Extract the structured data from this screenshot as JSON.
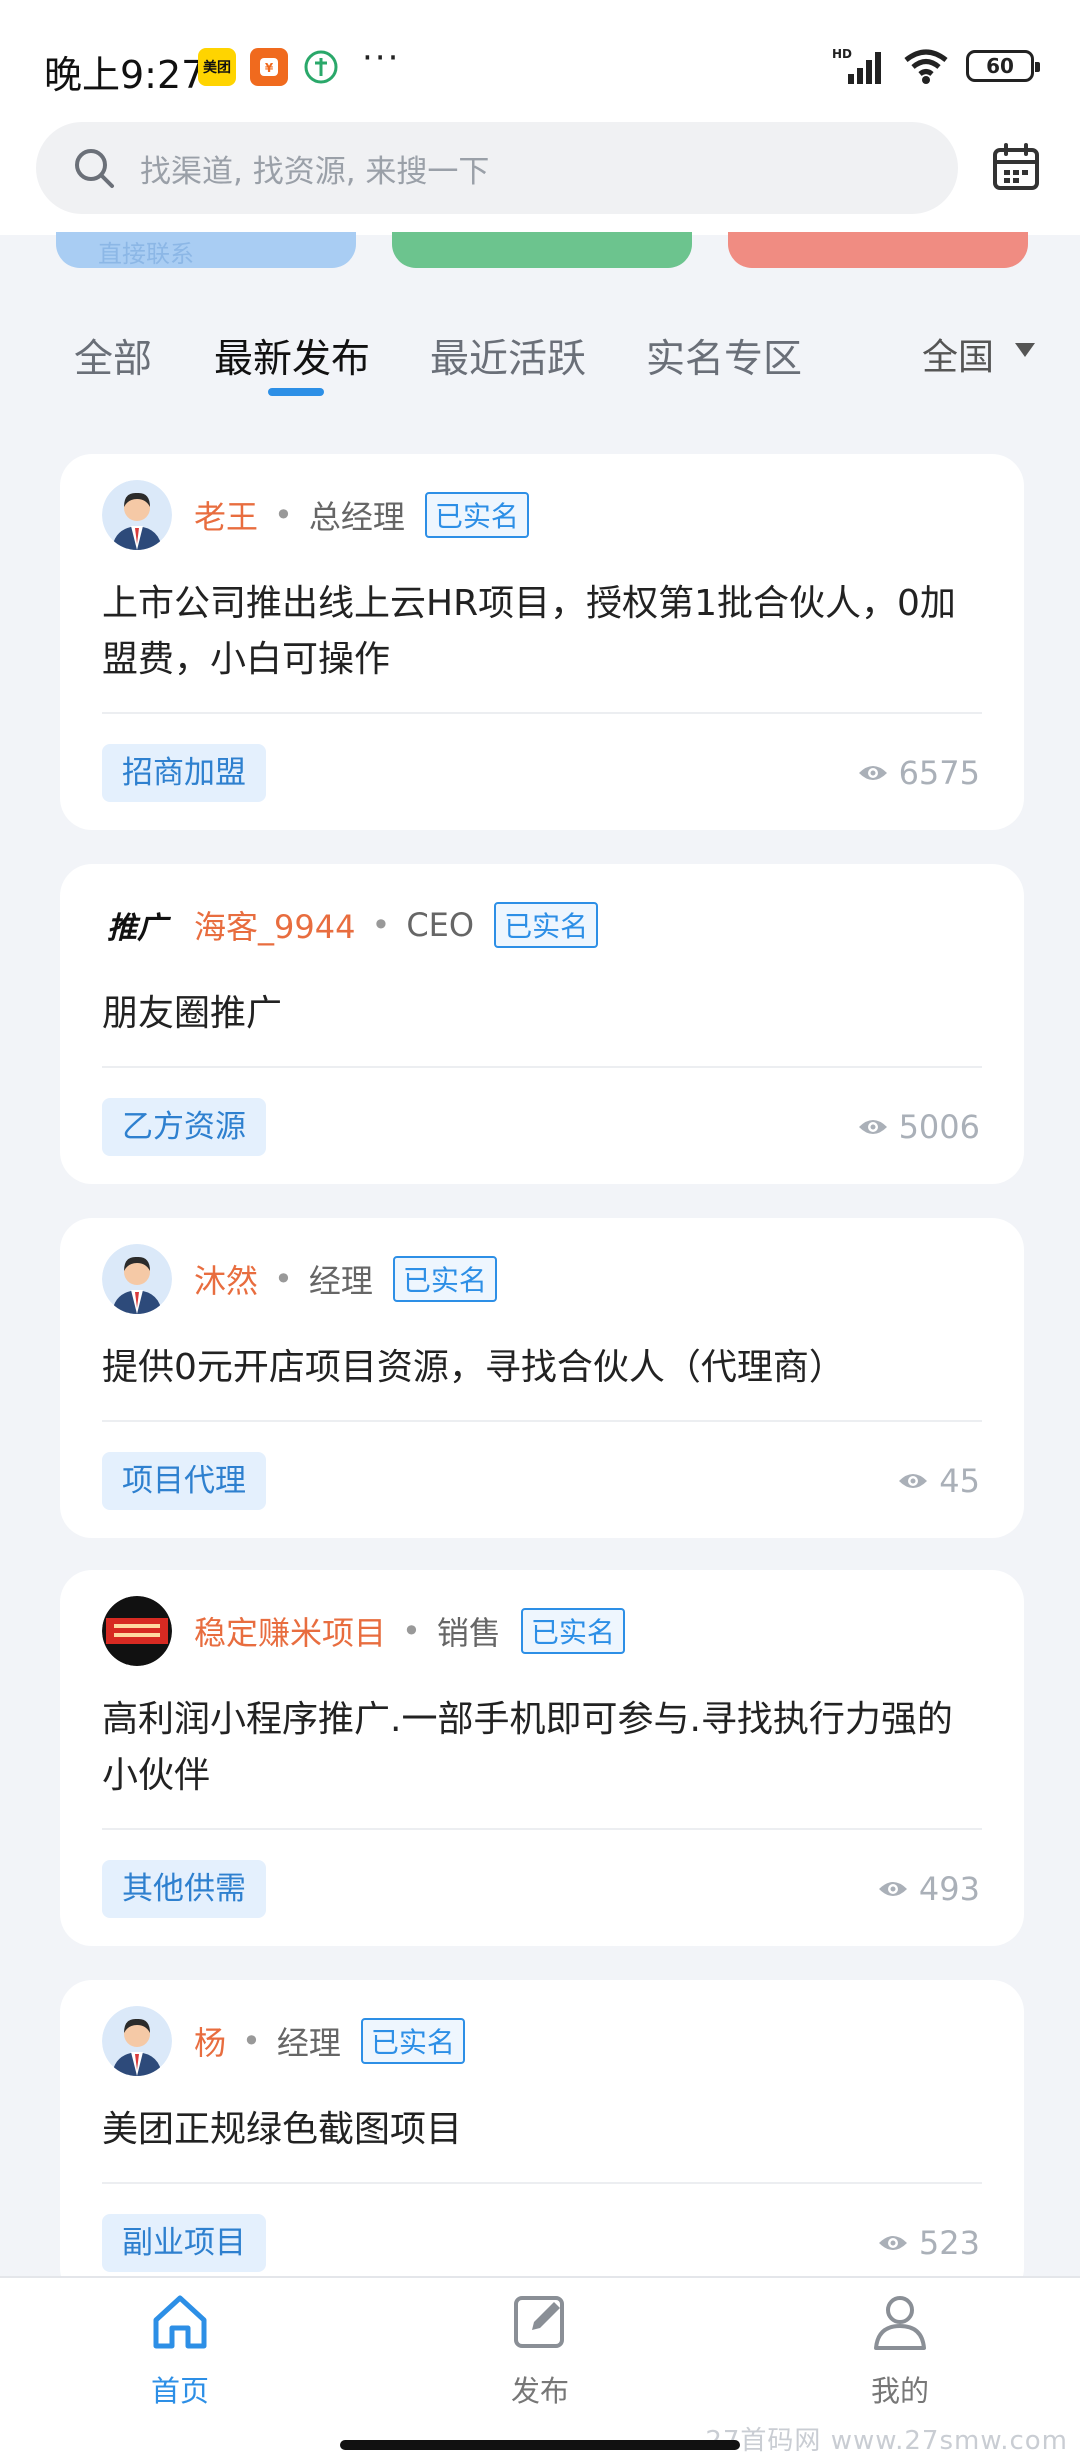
{
  "status_bar": {
    "time": "晚上9:27",
    "app_icons": [
      "美团",
      "支付",
      "绿"
    ],
    "overflow": "···",
    "network": "HD",
    "battery": "60"
  },
  "search": {
    "placeholder": "找渠道, 找资源, 来搜一下"
  },
  "banner_partial_text": "直接联系",
  "tabs": [
    {
      "label": "全部"
    },
    {
      "label": "最新发布"
    },
    {
      "label": "最近活跃"
    },
    {
      "label": "实名专区"
    }
  ],
  "active_tab": "最新发布",
  "region": {
    "label": "全国"
  },
  "posts": [
    {
      "name": "老王",
      "role": "总经理",
      "badge": "已实名",
      "title": "上市公司推出线上云HR项目，授权第1批合伙人，0加盟费，小白可操作",
      "tag": "招商加盟",
      "views": "6575",
      "avatar": "person"
    },
    {
      "name": "海客_9944",
      "role": "CEO",
      "badge": "已实名",
      "title": "朋友圈推广",
      "tag": "乙方资源",
      "views": "5006",
      "avatar": "text-logo",
      "avatar_text": "推广"
    },
    {
      "name": "沐然",
      "role": "经理",
      "badge": "已实名",
      "title": "提供0元开店项目资源，寻找合伙人（代理商）",
      "tag": "项目代理",
      "views": "45",
      "avatar": "person"
    },
    {
      "name": "稳定赚米项目",
      "role": "销售",
      "badge": "已实名",
      "title": "高利润小程序推广.一部手机即可参与.寻找执行力强的小伙伴",
      "tag": "其他供需",
      "views": "493",
      "avatar": "red-logo"
    },
    {
      "name": "杨",
      "role": "经理",
      "badge": "已实名",
      "title": "美团正规绿色截图项目",
      "tag": "副业项目",
      "views": "523",
      "avatar": "person"
    }
  ],
  "bottom_nav": [
    {
      "label": "首页",
      "icon": "home-icon",
      "active": true
    },
    {
      "label": "发布",
      "icon": "edit-icon",
      "active": false
    },
    {
      "label": "我的",
      "icon": "user-icon",
      "active": false
    }
  ],
  "watermark": "27首码网 www.27smw.com",
  "colors": {
    "accent": "#2d8fe6",
    "username": "#e86d3f",
    "tag_bg": "#e4f0fd",
    "banner_blue": "#a9cdf3",
    "banner_green": "#6cc48e",
    "banner_red": "#f08c82"
  }
}
